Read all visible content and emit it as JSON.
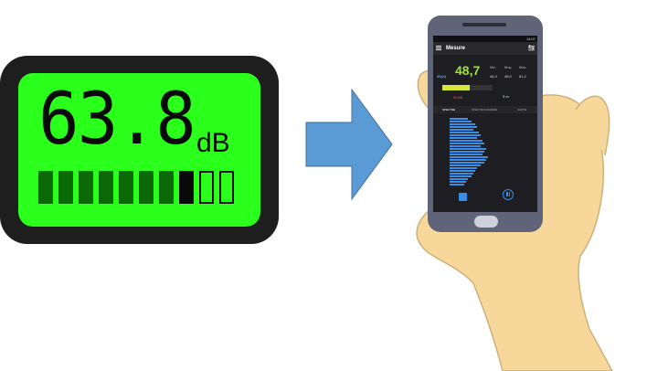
{
  "meter": {
    "value": "63.8",
    "unit": "dB",
    "level_segments": 12,
    "lit_segments": 8,
    "colors": {
      "screen": "#2bff1c",
      "frame": "#1e1e1e",
      "segment_dim": "#0b6a07",
      "segment_lit": "#0a0a0a"
    }
  },
  "arrow": {
    "color": "#5b9bd5",
    "icon": "right-arrow-icon"
  },
  "phone": {
    "status_time": "14:07",
    "app_title": "Mesure",
    "current_level": "48,7",
    "unit_label": "dB(A)",
    "stats": {
      "min_label": "Min",
      "min_value": "46,3",
      "avg_label": "Moy",
      "avg_value": "48,0",
      "max_label": "Max",
      "max_value": "81,2"
    },
    "level_fraction": 0.55,
    "record_label": "00:55",
    "timer_label": "3 m",
    "tabs": [
      "SPECTRE",
      "SPECTROGRAMME",
      "CARTE"
    ],
    "accent_color": "#3a8ee6",
    "value_color": "#9be534"
  }
}
